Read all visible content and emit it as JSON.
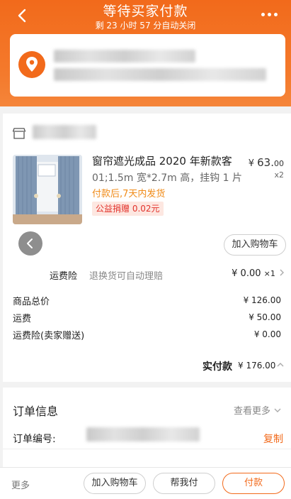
{
  "header": {
    "title": "等待买家付款",
    "subtitle": "剩 23 小时 57 分自动关闭"
  },
  "product": {
    "name": "窗帘遮光成品 2020 年新款客",
    "spec": "01;1.5m 宽*2.7m 高，挂钩 1 片",
    "price_symbol": "¥",
    "price_int": "63.",
    "price_dec": "00",
    "qty": "x2",
    "ship_note": "付款后,7天内发货",
    "charity": "公益捐赠 0.02元"
  },
  "buttons": {
    "add_to_cart": "加入购物车",
    "add_to_cart2": "加入购物车",
    "help_pay": "帮我付",
    "pay": "付款",
    "more": "更多"
  },
  "insurance": {
    "label": "运费险",
    "desc": "退换货可自动理赔",
    "value": "¥ 0.00",
    "mult": "×1"
  },
  "summary": [
    {
      "label": "商品总价",
      "value": "¥ 126.00"
    },
    {
      "label": "运费",
      "value": "¥ 50.00"
    },
    {
      "label": "运费险(卖家赠送)",
      "value": "¥ 0.00"
    }
  ],
  "total": {
    "label": "实付款",
    "value": "¥ 176.00"
  },
  "order": {
    "title": "订单信息",
    "view_more": "查看更多",
    "number_label": "订单编号:",
    "copy": "复制"
  },
  "icons": {
    "back": "back-arrow-icon",
    "more": "more-dots-icon",
    "location": "location-pin-icon",
    "store": "store-icon"
  },
  "colors": {
    "accent": "#f26a1b",
    "charity_text": "#e2322b",
    "ship_text": "#f08b18"
  }
}
